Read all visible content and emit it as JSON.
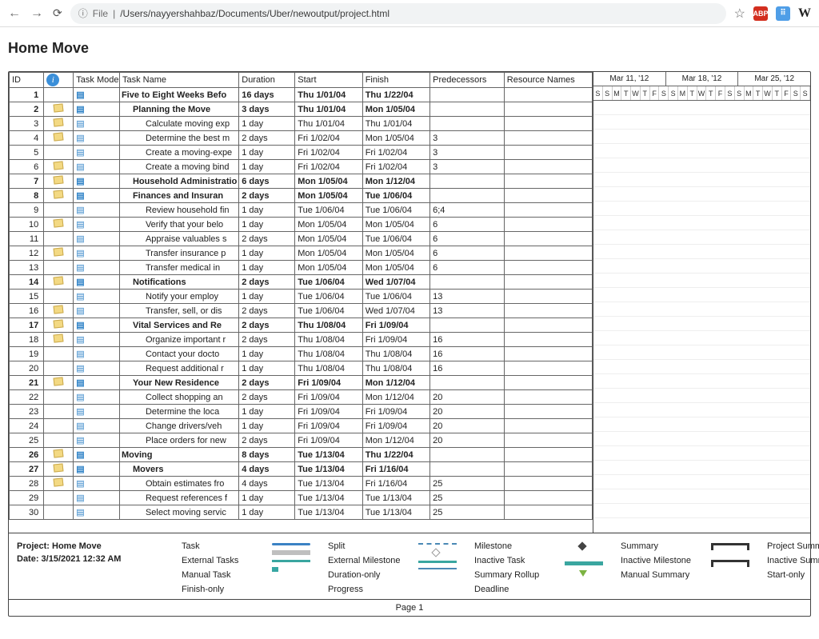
{
  "url": {
    "prefix": "File",
    "path": "/Users/nayyershahbaz/Documents/Uber/newoutput/project.html"
  },
  "star": "☆",
  "page_title": "Home Move",
  "headers": {
    "id": "ID",
    "task_mode": "Task Mode",
    "task_name": "Task Name",
    "duration": "Duration",
    "start": "Start",
    "finish": "Finish",
    "predecessors": "Predecessors",
    "resource_names": "Resource Names"
  },
  "timeline": {
    "weeks": [
      "Mar 11, '12",
      "Mar 18, '12",
      "Mar 25, '12"
    ],
    "days": [
      "S",
      "S",
      "M",
      "T",
      "W",
      "T",
      "F",
      "S",
      "S",
      "M",
      "T",
      "W",
      "T",
      "F",
      "S",
      "S",
      "M",
      "T",
      "W",
      "T",
      "F",
      "S",
      "S"
    ]
  },
  "tasks": [
    {
      "id": "1",
      "note": false,
      "indent": 0,
      "bold": true,
      "name": "Five to Eight Weeks Befo",
      "dur": "16 days",
      "start": "Thu 1/01/04",
      "finish": "Thu 1/22/04",
      "pred": ""
    },
    {
      "id": "2",
      "note": true,
      "indent": 1,
      "bold": true,
      "name": "Planning the Move",
      "dur": "3 days",
      "start": "Thu 1/01/04",
      "finish": "Mon 1/05/04",
      "pred": ""
    },
    {
      "id": "3",
      "note": true,
      "indent": 2,
      "bold": false,
      "name": "Calculate moving exp",
      "dur": "1 day",
      "start": "Thu 1/01/04",
      "finish": "Thu 1/01/04",
      "pred": ""
    },
    {
      "id": "4",
      "note": true,
      "indent": 2,
      "bold": false,
      "name": "Determine the best m",
      "dur": "2 days",
      "start": "Fri 1/02/04",
      "finish": "Mon 1/05/04",
      "pred": "3"
    },
    {
      "id": "5",
      "note": false,
      "indent": 2,
      "bold": false,
      "name": "Create a moving-expe",
      "dur": "1 day",
      "start": "Fri 1/02/04",
      "finish": "Fri 1/02/04",
      "pred": "3"
    },
    {
      "id": "6",
      "note": true,
      "indent": 2,
      "bold": false,
      "name": "Create a moving bind",
      "dur": "1 day",
      "start": "Fri 1/02/04",
      "finish": "Fri 1/02/04",
      "pred": "3"
    },
    {
      "id": "7",
      "note": true,
      "indent": 1,
      "bold": true,
      "name": "Household Administratio",
      "dur": "6 days",
      "start": "Mon 1/05/04",
      "finish": "Mon 1/12/04",
      "pred": ""
    },
    {
      "id": "8",
      "note": true,
      "indent": 1,
      "bold": true,
      "name": "Finances and Insuran",
      "dur": "2 days",
      "start": "Mon 1/05/04",
      "finish": "Tue 1/06/04",
      "pred": ""
    },
    {
      "id": "9",
      "note": false,
      "indent": 2,
      "bold": false,
      "name": "Review household fin",
      "dur": "1 day",
      "start": "Tue 1/06/04",
      "finish": "Tue 1/06/04",
      "pred": "6;4"
    },
    {
      "id": "10",
      "note": true,
      "indent": 2,
      "bold": false,
      "name": "Verify that your belo",
      "dur": "1 day",
      "start": "Mon 1/05/04",
      "finish": "Mon 1/05/04",
      "pred": "6"
    },
    {
      "id": "11",
      "note": false,
      "indent": 2,
      "bold": false,
      "name": "Appraise valuables s",
      "dur": "2 days",
      "start": "Mon 1/05/04",
      "finish": "Tue 1/06/04",
      "pred": "6"
    },
    {
      "id": "12",
      "note": true,
      "indent": 2,
      "bold": false,
      "name": "Transfer insurance p",
      "dur": "1 day",
      "start": "Mon 1/05/04",
      "finish": "Mon 1/05/04",
      "pred": "6"
    },
    {
      "id": "13",
      "note": false,
      "indent": 2,
      "bold": false,
      "name": "Transfer medical in",
      "dur": "1 day",
      "start": "Mon 1/05/04",
      "finish": "Mon 1/05/04",
      "pred": "6"
    },
    {
      "id": "14",
      "note": true,
      "indent": 1,
      "bold": true,
      "name": "Notifications",
      "dur": "2 days",
      "start": "Tue 1/06/04",
      "finish": "Wed 1/07/04",
      "pred": ""
    },
    {
      "id": "15",
      "note": false,
      "indent": 2,
      "bold": false,
      "name": "Notify your employ",
      "dur": "1 day",
      "start": "Tue 1/06/04",
      "finish": "Tue 1/06/04",
      "pred": "13"
    },
    {
      "id": "16",
      "note": true,
      "indent": 2,
      "bold": false,
      "name": "Transfer, sell, or dis",
      "dur": "2 days",
      "start": "Tue 1/06/04",
      "finish": "Wed 1/07/04",
      "pred": "13"
    },
    {
      "id": "17",
      "note": true,
      "indent": 1,
      "bold": true,
      "name": "Vital Services and Re",
      "dur": "2 days",
      "start": "Thu 1/08/04",
      "finish": "Fri 1/09/04",
      "pred": ""
    },
    {
      "id": "18",
      "note": true,
      "indent": 2,
      "bold": false,
      "name": "Organize important r",
      "dur": "2 days",
      "start": "Thu 1/08/04",
      "finish": "Fri 1/09/04",
      "pred": "16"
    },
    {
      "id": "19",
      "note": false,
      "indent": 2,
      "bold": false,
      "name": "Contact your docto",
      "dur": "1 day",
      "start": "Thu 1/08/04",
      "finish": "Thu 1/08/04",
      "pred": "16"
    },
    {
      "id": "20",
      "note": false,
      "indent": 2,
      "bold": false,
      "name": "Request additional r",
      "dur": "1 day",
      "start": "Thu 1/08/04",
      "finish": "Thu 1/08/04",
      "pred": "16"
    },
    {
      "id": "21",
      "note": true,
      "indent": 1,
      "bold": true,
      "name": "Your New Residence",
      "dur": "2 days",
      "start": "Fri 1/09/04",
      "finish": "Mon 1/12/04",
      "pred": ""
    },
    {
      "id": "22",
      "note": false,
      "indent": 2,
      "bold": false,
      "name": "Collect shopping an",
      "dur": "2 days",
      "start": "Fri 1/09/04",
      "finish": "Mon 1/12/04",
      "pred": "20"
    },
    {
      "id": "23",
      "note": false,
      "indent": 2,
      "bold": false,
      "name": "Determine the loca",
      "dur": "1 day",
      "start": "Fri 1/09/04",
      "finish": "Fri 1/09/04",
      "pred": "20"
    },
    {
      "id": "24",
      "note": false,
      "indent": 2,
      "bold": false,
      "name": "Change drivers/veh",
      "dur": "1 day",
      "start": "Fri 1/09/04",
      "finish": "Fri 1/09/04",
      "pred": "20"
    },
    {
      "id": "25",
      "note": false,
      "indent": 2,
      "bold": false,
      "name": "Place orders for new",
      "dur": "2 days",
      "start": "Fri 1/09/04",
      "finish": "Mon 1/12/04",
      "pred": "20"
    },
    {
      "id": "26",
      "note": true,
      "indent": 0,
      "bold": true,
      "name": "Moving",
      "dur": "8 days",
      "start": "Tue 1/13/04",
      "finish": "Thu 1/22/04",
      "pred": ""
    },
    {
      "id": "27",
      "note": true,
      "indent": 1,
      "bold": true,
      "name": "Movers",
      "dur": "4 days",
      "start": "Tue 1/13/04",
      "finish": "Fri 1/16/04",
      "pred": ""
    },
    {
      "id": "28",
      "note": true,
      "indent": 2,
      "bold": false,
      "name": "Obtain estimates fro",
      "dur": "4 days",
      "start": "Tue 1/13/04",
      "finish": "Fri 1/16/04",
      "pred": "25"
    },
    {
      "id": "29",
      "note": false,
      "indent": 2,
      "bold": false,
      "name": "Request references f",
      "dur": "1 day",
      "start": "Tue 1/13/04",
      "finish": "Tue 1/13/04",
      "pred": "25"
    },
    {
      "id": "30",
      "note": false,
      "indent": 2,
      "bold": false,
      "name": "Select moving servic",
      "dur": "1 day",
      "start": "Tue 1/13/04",
      "finish": "Tue 1/13/04",
      "pred": "25"
    }
  ],
  "legend": {
    "project_label": "Project: Home Move",
    "date_label": "Date: 3/15/2021 12:32 AM",
    "c1": [
      "Task",
      "External Tasks",
      "Manual Task",
      "Finish-only"
    ],
    "c2": [
      "Split",
      "External Milestone",
      "Duration-only",
      "Progress"
    ],
    "c3": [
      "Milestone",
      "Inactive Task",
      "Summary Rollup",
      "Deadline"
    ],
    "c4": [
      "Summary",
      "Inactive Milestone",
      "Manual Summary",
      ""
    ],
    "c5": [
      "Project Summary",
      "Inactive Summary",
      "Start-only",
      ""
    ]
  },
  "footer": "Page 1"
}
